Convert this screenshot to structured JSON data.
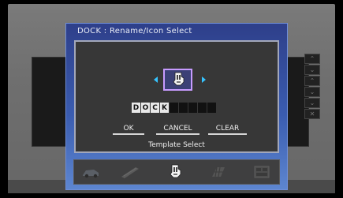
{
  "dialog": {
    "title": "DOCK : Rename/Icon Select",
    "name_chars": [
      "D",
      "O",
      "C",
      "K",
      "",
      "",
      "",
      "",
      ""
    ],
    "buttons": {
      "ok": "OK",
      "cancel": "CANCEL",
      "clear": "CLEAR"
    },
    "template_select": "Template Select",
    "selected_icon": "dock-icon"
  },
  "icon_tray": [
    {
      "name": "car-icon"
    },
    {
      "name": "rail-icon"
    },
    {
      "name": "dock-icon"
    },
    {
      "name": "grid-icon"
    },
    {
      "name": "panel-icon"
    }
  ],
  "side_buttons": [
    "⌃",
    "⌄",
    "⌃",
    "⌄",
    "⌄",
    "✕"
  ],
  "colors": {
    "dialog_top": "#2e3f8a",
    "dialog_bottom": "#5d86d0",
    "selection_border": "#c79bff",
    "arrow": "#36c4ff"
  }
}
